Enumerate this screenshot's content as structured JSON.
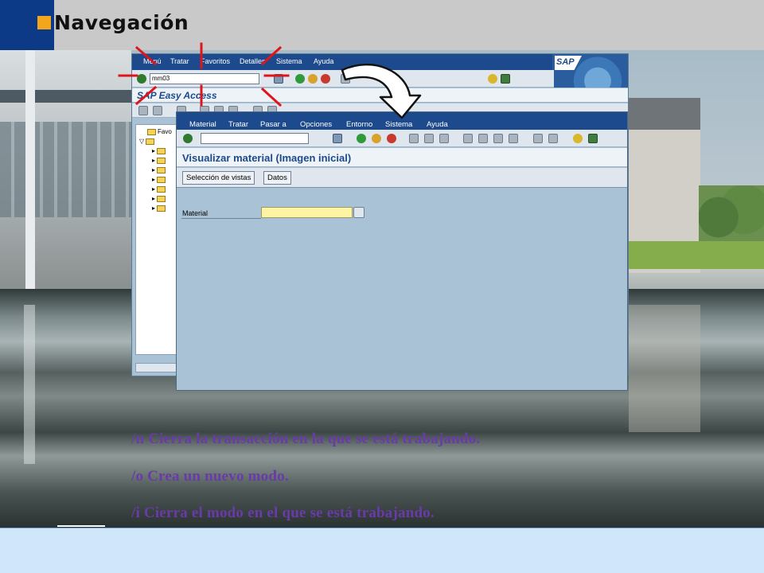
{
  "slide": {
    "title": "Navegación"
  },
  "win1": {
    "menu": [
      "Menú",
      "Tratar",
      "Favoritos",
      "Detalles",
      "Sistema",
      "Ayuda"
    ],
    "command_value": "mm03",
    "title": "SAP Easy Access",
    "logo": "SAP",
    "tree": {
      "root": "Favo"
    }
  },
  "win2": {
    "menu": [
      "Material",
      "Tratar",
      "Pasar a",
      "Opciones",
      "Entorno",
      "Sistema",
      "Ayuda"
    ],
    "title": "Visualizar material (Imagen inicial)",
    "buttons": [
      "Selección de vistas",
      "Datos"
    ],
    "field": {
      "label": "Material",
      "value": ""
    }
  },
  "notes": [
    "/n  Cierra la transacción en la que se está trabajando.",
    "/o  Crea un nuevo modo.",
    "/i  Cierra el modo en el que se está trabajando."
  ],
  "colors": {
    "header_blue": "#0c3a86",
    "accent": "#f3a51c",
    "sap_menu": "#1d4a8c",
    "note_text": "#6a3aa8",
    "highlight": "#e0151a"
  }
}
